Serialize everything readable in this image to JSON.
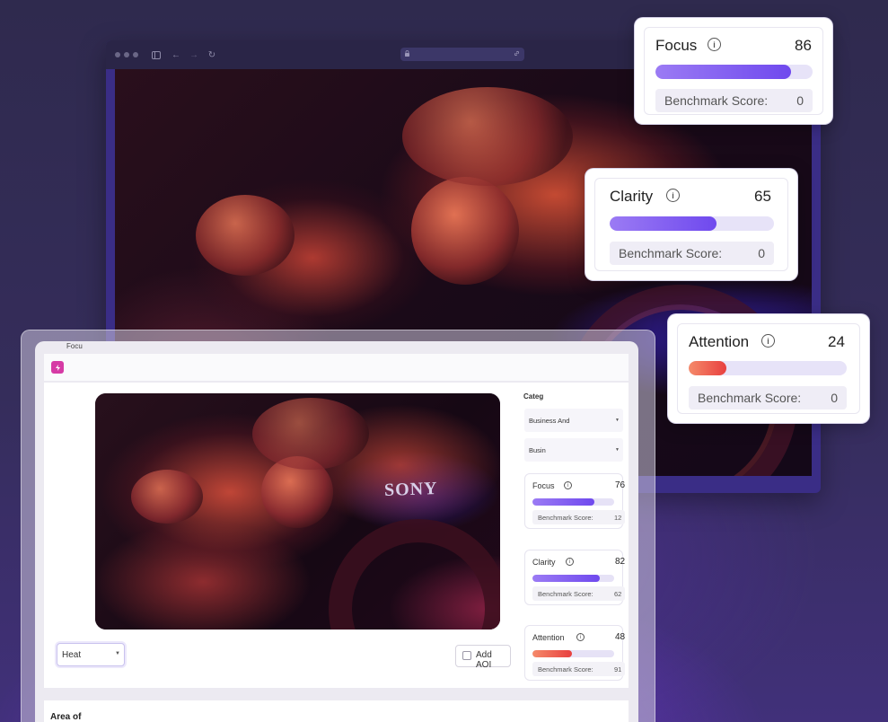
{
  "colors": {
    "violet_fill": "#6f49ee",
    "violet_fill_light": "#9b7bf4",
    "red_fill": "#e8403f",
    "red_fill_light": "#f58a6a"
  },
  "back_browser": {
    "url_icons": [
      "lock-icon",
      "link-icon"
    ]
  },
  "score_cards": [
    {
      "title": "Focus",
      "score": "86",
      "benchmark_label": "Benchmark Score:",
      "benchmark_value": "0",
      "progress": 0.86,
      "color": "violet"
    },
    {
      "title": "Clarity",
      "score": "65",
      "benchmark_label": "Benchmark Score:",
      "benchmark_value": "0",
      "progress": 0.65,
      "color": "violet"
    },
    {
      "title": "Attention",
      "score": "24",
      "benchmark_label": "Benchmark Score:",
      "benchmark_value": "0",
      "progress": 0.24,
      "color": "red"
    }
  ],
  "app": {
    "window_title": "Focu",
    "heatmap_select": "Heat",
    "add_aoi_label": "Add AOI",
    "area_title": "Area of",
    "sidebar": {
      "category_label": "Categ",
      "category_select": "Business And",
      "subcategory_select": "Busin",
      "metrics": [
        {
          "title": "Focus",
          "score": "76",
          "benchmark_label": "Benchmark Score:",
          "benchmark_value": "12",
          "progress": 0.76,
          "color": "violet"
        },
        {
          "title": "Clarity",
          "score": "82",
          "benchmark_label": "Benchmark Score:",
          "benchmark_value": "62",
          "progress": 0.82,
          "color": "violet"
        },
        {
          "title": "Attention",
          "score": "48",
          "benchmark_label": "Benchmark Score:",
          "benchmark_value": "91",
          "progress": 0.48,
          "color": "red"
        }
      ]
    },
    "preview_brand": "SONY"
  }
}
